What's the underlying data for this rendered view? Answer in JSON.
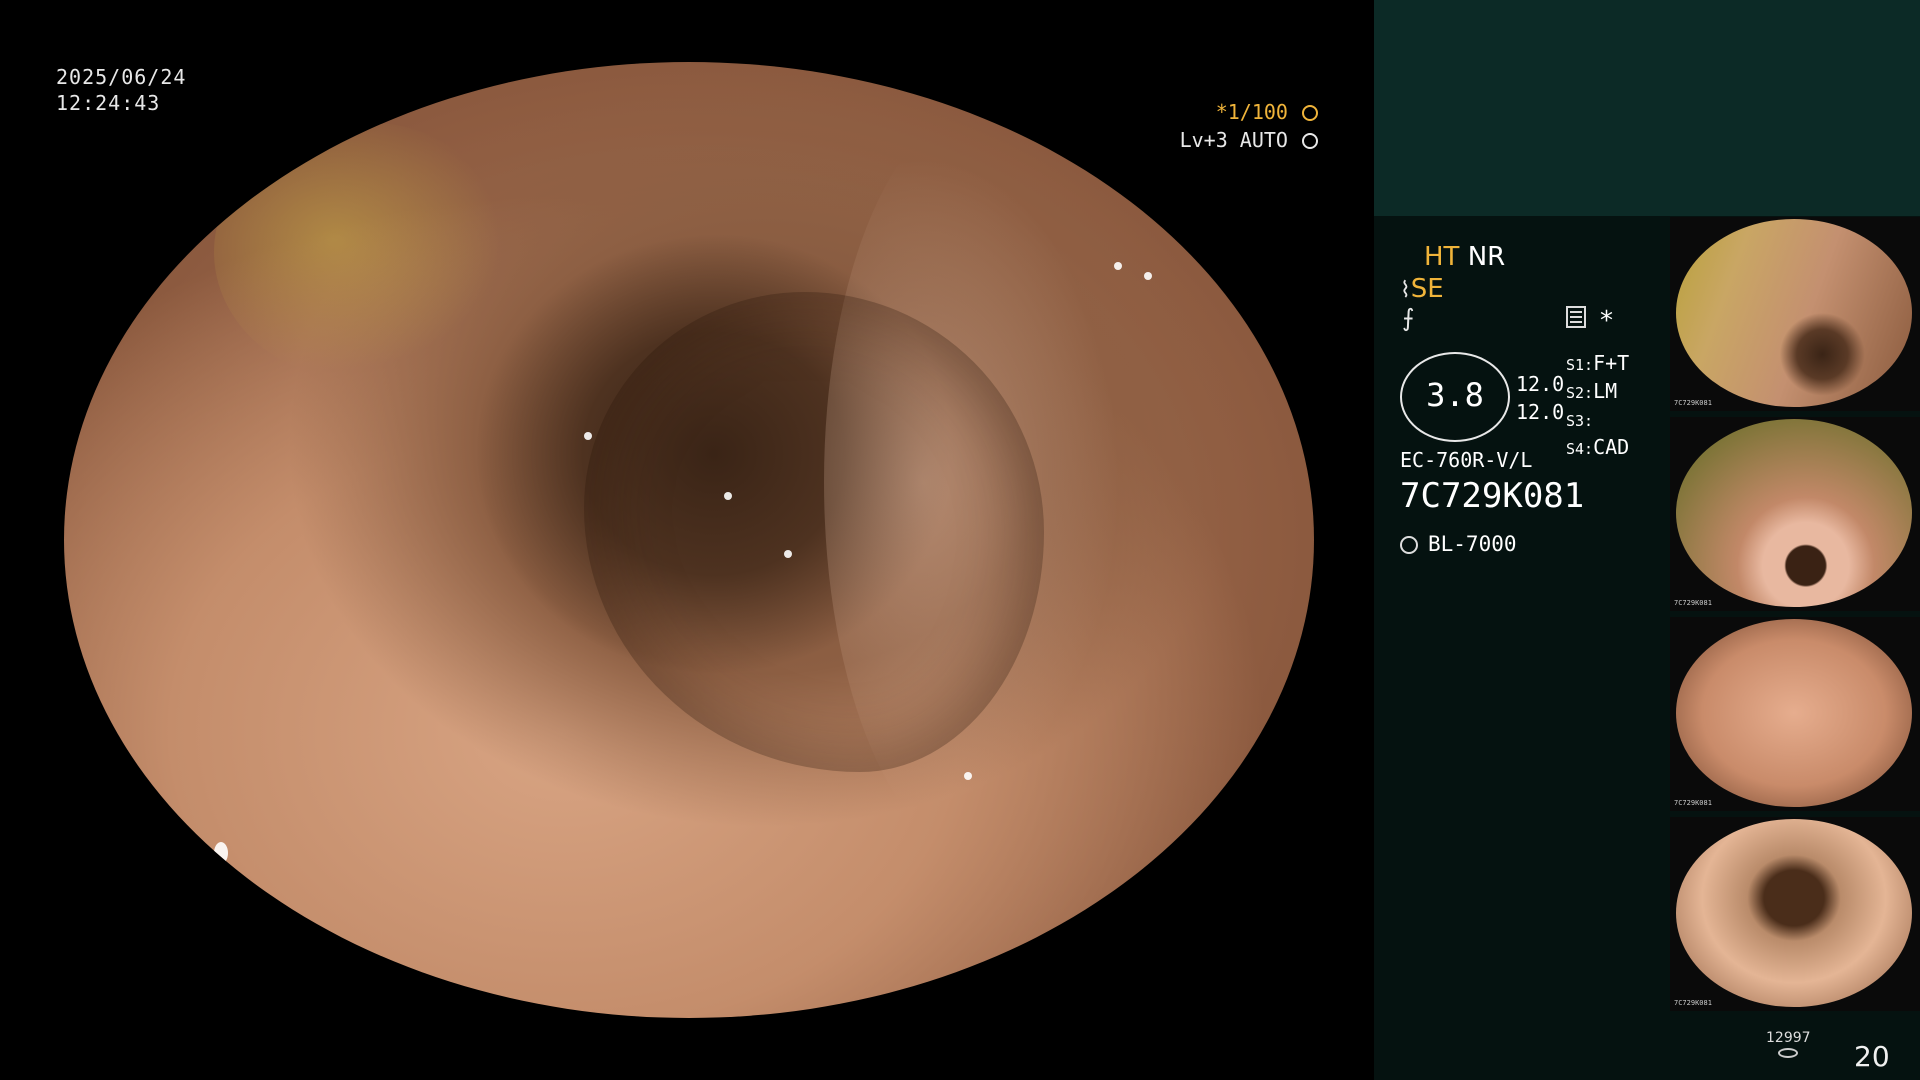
{
  "overlay": {
    "date": "2025/06/24",
    "time": "12:24:43",
    "shutter": "*1/100",
    "level": "Lv+3 AUTO"
  },
  "panel": {
    "ht_label": "HT",
    "nr_label": "NR",
    "se_label": "SE",
    "asterisk": "*",
    "scope_value": "3.8",
    "num_top": "12.0",
    "num_bottom": "12.0",
    "switches": [
      {
        "key": "S1:",
        "value": "F+T"
      },
      {
        "key": "S2:",
        "value": "LM"
      },
      {
        "key": "S3:",
        "value": ""
      },
      {
        "key": "S4:",
        "value": "CAD"
      }
    ],
    "scope_model": "EC-760R-V/L",
    "scope_serial": "7C729K081",
    "light_source": "BL-7000",
    "thumb_tag": "7C729K081",
    "image_count_small": "12997",
    "image_count": "20"
  },
  "icons": {
    "shutter_icon": "aperture-icon",
    "level_icon": "target-icon",
    "se_icon": "curve-icon",
    "menu_icon": "menu-icon",
    "light_icon": "sun-icon",
    "disk_icon": "disk-icon"
  },
  "colors": {
    "accent_yellow": "#f0b43a",
    "panel_bg": "#051210",
    "panel_top": "#0c2a26"
  }
}
